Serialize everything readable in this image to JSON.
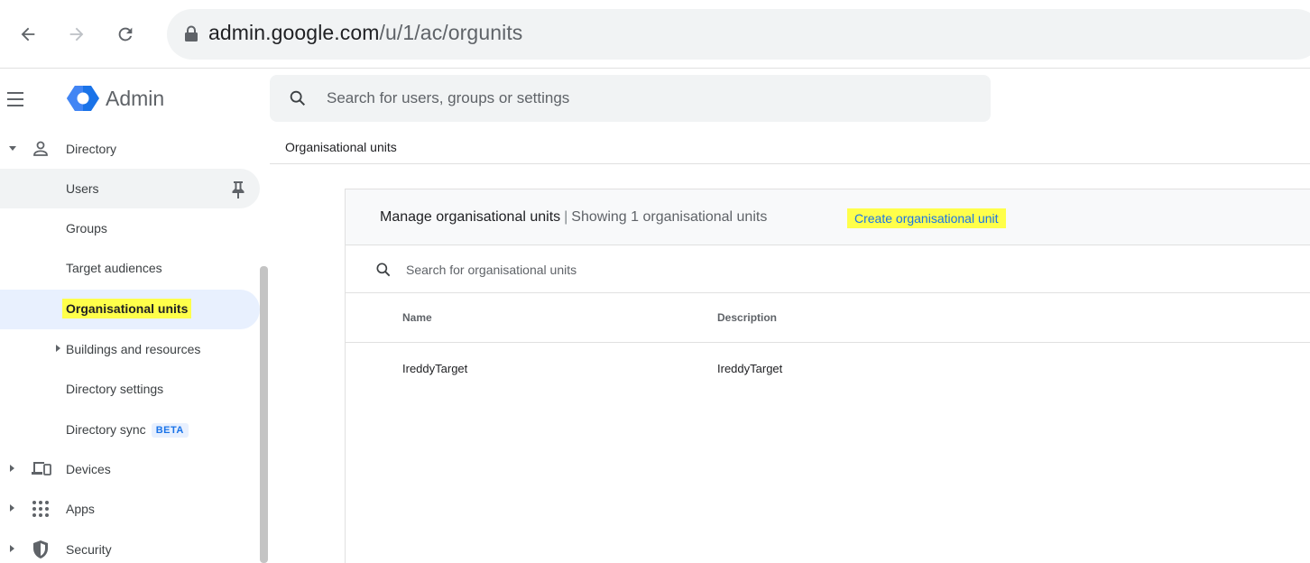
{
  "browser": {
    "url_host": "admin.google.com",
    "url_path": "/u/1/ac/orgunits"
  },
  "header": {
    "brand": "Admin",
    "search_placeholder": "Search for users, groups or settings"
  },
  "breadcrumb": "Organisational units",
  "sidebar": {
    "directory_label": "Directory",
    "items": [
      {
        "label": "Users",
        "state": "hover"
      },
      {
        "label": "Groups"
      },
      {
        "label": "Target audiences"
      },
      {
        "label": "Organisational units",
        "state": "active"
      },
      {
        "label": "Buildings and resources",
        "expandable": true
      },
      {
        "label": "Directory settings"
      },
      {
        "label": "Directory sync",
        "badge": "BETA"
      }
    ],
    "sections": [
      {
        "label": "Devices",
        "icon": "devices-icon"
      },
      {
        "label": "Apps",
        "icon": "apps-grid-icon"
      },
      {
        "label": "Security",
        "icon": "shield-icon"
      }
    ]
  },
  "panel": {
    "title": "Manage organisational units",
    "separator": "|",
    "count_text": "Showing 1 organisational units",
    "create_label": "Create organisational unit",
    "search_placeholder": "Search for organisational units",
    "columns": [
      "Name",
      "Description"
    ],
    "rows": [
      {
        "name": "IreddyTarget",
        "description": "IreddyTarget"
      }
    ]
  },
  "colors": {
    "highlight": "#ffff4a",
    "active_bg": "#e8f0fe",
    "link": "#1a73e8"
  }
}
